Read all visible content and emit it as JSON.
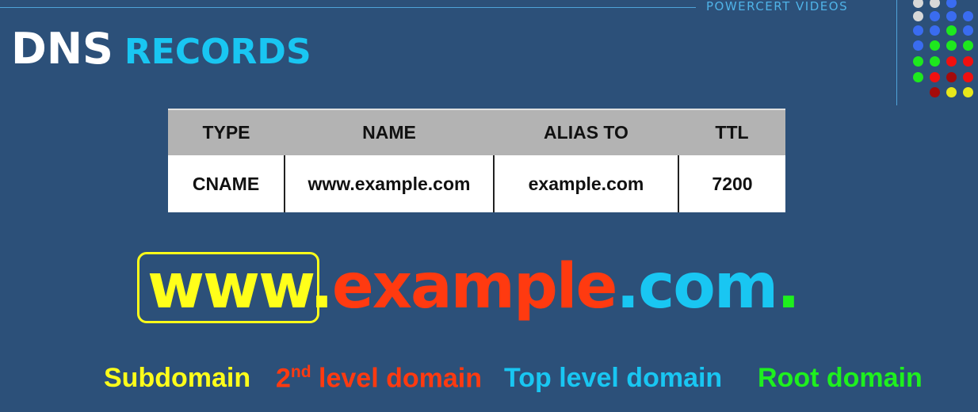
{
  "brand": "POWERCERT VIDEOS",
  "title": {
    "dns": "DNS",
    "records": "RECORDS"
  },
  "table": {
    "headers": [
      "TYPE",
      "NAME",
      "ALIAS TO",
      "TTL"
    ],
    "row": [
      "CNAME",
      "www.example.com",
      "example.com",
      "7200"
    ]
  },
  "domain": {
    "subdomain": "www.",
    "second_level": "example",
    "top_level": ".com",
    "root": "."
  },
  "legend": {
    "subdomain": "Subdomain",
    "second_level_prefix": "2",
    "second_level_sup": "nd",
    "second_level_suffix": " level domain",
    "top_level": "Top level domain",
    "root": "Root domain"
  },
  "colors": {
    "background": "#2c5079",
    "subdomain": "#ffff1a",
    "second_level": "#ff3a10",
    "top_level": "#19c6f2",
    "root": "#1ef01e",
    "table_header": "#b3b3b3"
  },
  "decoration": {
    "dot_rows": [
      [
        "white",
        "white",
        "blue"
      ],
      [
        "white",
        "blue",
        "blue",
        "blue",
        "green"
      ],
      [
        "blue",
        "blue",
        "green",
        "blue",
        "green"
      ],
      [
        "blue",
        "green",
        "green",
        "green",
        "red"
      ],
      [
        "green",
        "green",
        "red",
        "red",
        "darkred"
      ],
      [
        "green",
        "red",
        "darkred",
        "red",
        "yellow"
      ],
      [
        "darkred",
        "yellow",
        "yellow"
      ]
    ]
  }
}
